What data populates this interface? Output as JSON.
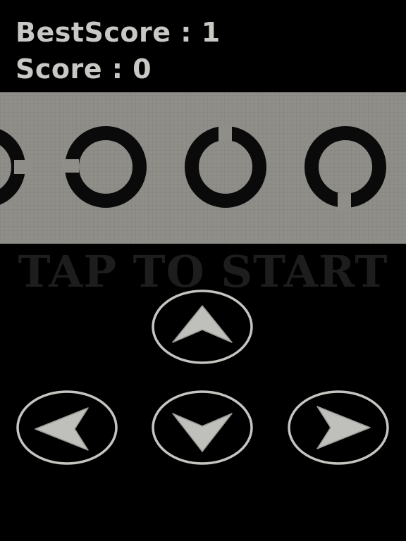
{
  "scoreboard": {
    "best_label": "BestScore : ",
    "best_value": "1",
    "score_label": "Score : ",
    "score_value": "0"
  },
  "eye_chart": {
    "ring_gaps": [
      "right",
      "left",
      "up",
      "down"
    ],
    "ring_color": "#0a0a0a",
    "band_color": "#8f8e89"
  },
  "prompt": {
    "tap_to_start": "TAP TO START"
  },
  "controls": {
    "up": "arrow-up-icon",
    "left": "arrow-left-icon",
    "down": "arrow-down-icon",
    "right": "arrow-right-icon",
    "arrow_color": "#bfbfbb",
    "ring_color": "#c4c4c0"
  }
}
